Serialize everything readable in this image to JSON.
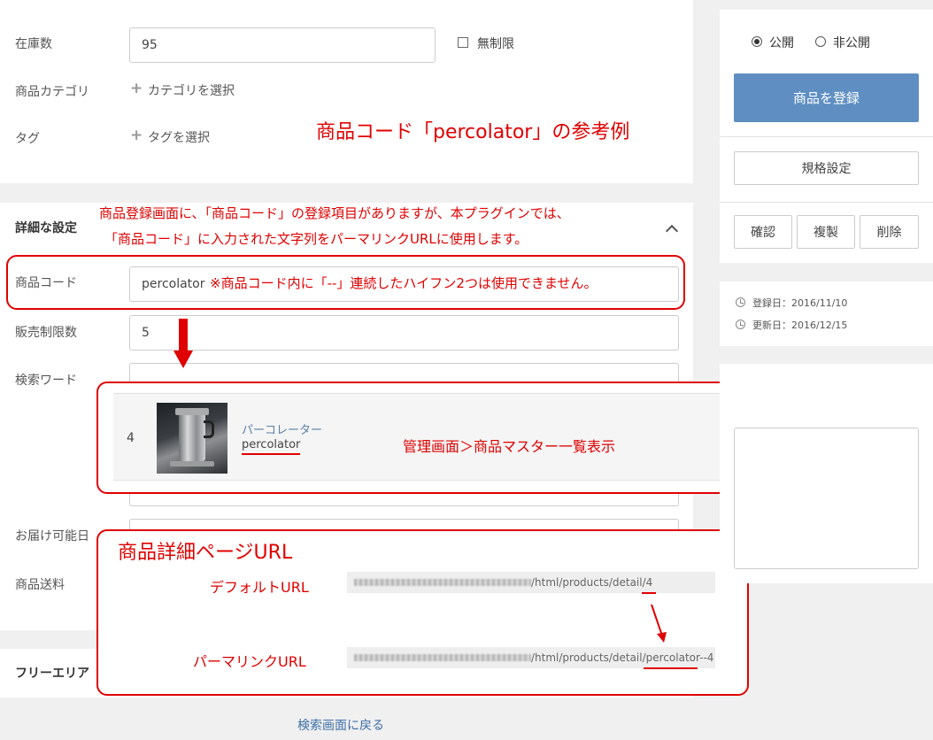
{
  "stock": {
    "label": "在庫数",
    "value": "95",
    "unlimited_label": "無制限",
    "unlimited_checked": false
  },
  "category": {
    "label": "商品カテゴリ",
    "select_label": "カテゴリを選択"
  },
  "tag": {
    "label": "タグ",
    "select_label": "タグを選択"
  },
  "detail_section": {
    "title": "詳細な設定",
    "product_code": {
      "label": "商品コード",
      "value": "percolator"
    },
    "sale_limit": {
      "label": "販売制限数",
      "value": "5"
    },
    "search_word": {
      "label": "検索ワード",
      "value": ""
    },
    "delivery_date": {
      "label": "お届け可能日",
      "value": ""
    },
    "shipping_fee": {
      "label": "商品送料"
    }
  },
  "free_area": {
    "title": "フリーエリア"
  },
  "back_link": "検索画面に戻る",
  "sidebar": {
    "public_label": "公開",
    "private_label": "非公開",
    "register_button": "商品を登録",
    "spec_button": "規格設定",
    "confirm_button": "確認",
    "duplicate_button": "複製",
    "delete_button": "削除",
    "registered_date": "登録日：2016/11/10",
    "updated_date": "更新日：2016/12/15"
  },
  "annotations": {
    "example_title": "商品コード「percolator」の参考例",
    "explanation_line1": "商品登録画面に、「商品コード」の登録項目がありますが、本プラグインでは、",
    "explanation_line2": "「商品コード」に入力された文字列をパーマリンクURLに使用します。",
    "hyphen_note": "※商品コード内に「--」連続したハイフン2つは使用できません。",
    "list_caption": "管理画面＞商品マスター一覧表示",
    "detail_url_title": "商品詳細ページURL",
    "default_url_label": "デフォルトURL",
    "permalink_url_label": "パーマリンクURL",
    "default_url_path": "/html/products/detail/",
    "default_url_id": "4",
    "permalink_url_path": "/html/products/detail/",
    "permalink_url_slug": "percolator--4"
  },
  "product_list_row": {
    "id": "4",
    "name": "パーコレーター",
    "code": "percolator",
    "menu_icon": "ellipsis-icon"
  },
  "colors": {
    "annotation_red": "#e00000",
    "primary_button": "#5f8fc2",
    "link_blue": "#3d70a8"
  }
}
